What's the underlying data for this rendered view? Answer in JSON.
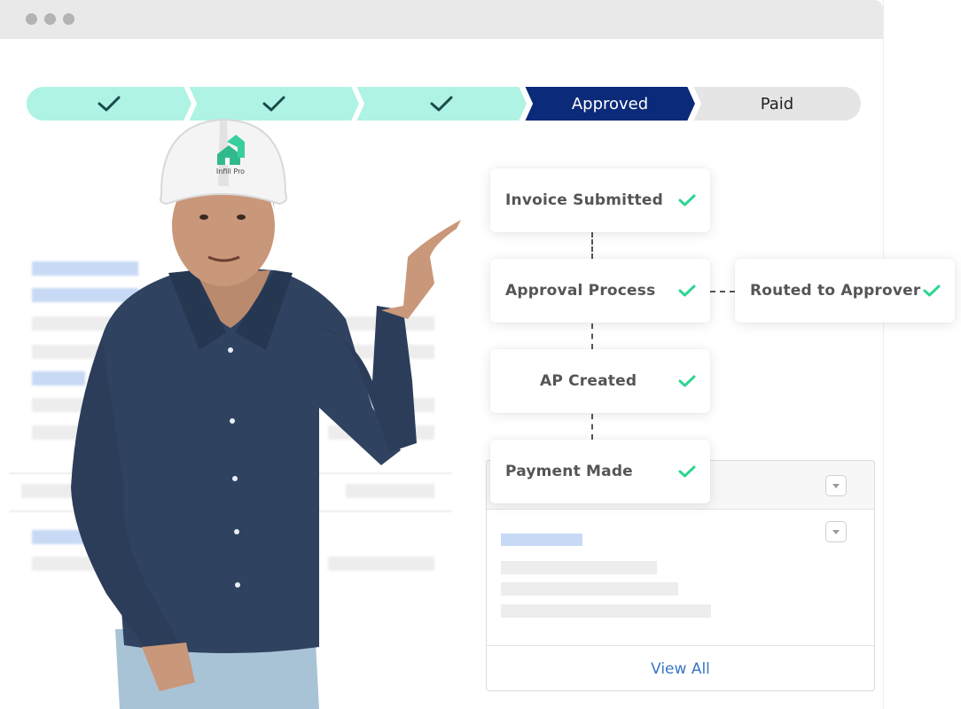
{
  "window": {
    "colors": {
      "chrome": "#e9e9ea",
      "dot": "#b3b3b5"
    }
  },
  "stepper": {
    "steps": [
      {
        "state": "done",
        "icon": "check-icon"
      },
      {
        "state": "done",
        "icon": "check-icon"
      },
      {
        "state": "done",
        "icon": "check-icon"
      },
      {
        "state": "current",
        "label": "Approved"
      },
      {
        "state": "upcoming",
        "label": "Paid"
      }
    ],
    "colors": {
      "done": "#aef3e4",
      "current": "#0b2a7a",
      "upcoming": "#e5e5e6",
      "check": "#1b4a4a"
    }
  },
  "flow": {
    "invoice_submitted": "Invoice Submitted",
    "approval_process": "Approval Process",
    "routed_to_approver": "Routed to Approver",
    "ap_created": "AP Created",
    "payment_made": "Payment Made",
    "check_color": "#2ed592"
  },
  "panel": {
    "view_all": "View All"
  },
  "hardhat": {
    "brand": "Infill Pro"
  }
}
